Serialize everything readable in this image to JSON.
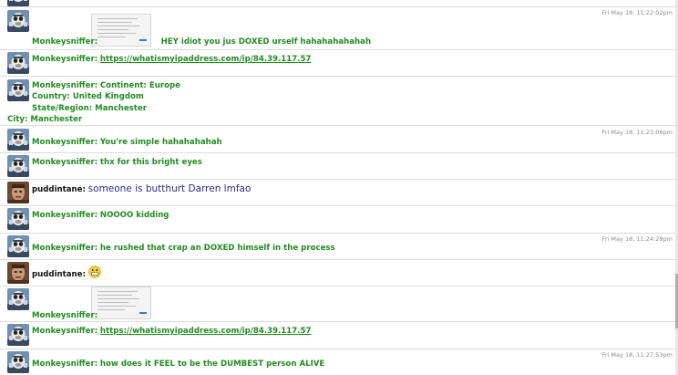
{
  "users": {
    "monkey": "Monkeysniffer:",
    "pudd": "puddintane:"
  },
  "colors": {
    "monkey_text": "#228b22",
    "pudd_text": "#2a2a8c",
    "timestamp": "#8c8c8c"
  },
  "messages": [
    {
      "time": "Fri May 18, 11:22:02pm",
      "text": "HEY idiot you jus DOXED urself hahahahahahah"
    },
    {
      "link": "https://whatismyipaddress.com/ip/84.39.117.57"
    },
    {
      "lines": [
        "Continent: Europe",
        "Country: United Kingdom",
        "State/Region: Manchester"
      ],
      "cont": "City: Manchester"
    },
    {
      "time": "Fri May 18, 11:23:06pm",
      "text": "You're simple hahahahahah"
    },
    {
      "text": "thx for this bright eyes"
    },
    {
      "text": "someone is butthurt Darren lmfao"
    },
    {
      "text": "NOOOO kidding"
    },
    {
      "time": "Fri May 18, 11:24:28pm",
      "text": "he rushed that crap an DOXED himself in the process"
    },
    {
      "emoji": "grinning-face-icon"
    },
    {
      "attachment": "screenshot-thumbnail"
    },
    {
      "link": "https://whatismyipaddress.com/ip/84.39.117.57"
    },
    {
      "time": "Fri May 18, 11:27:53pm",
      "text": "how does it FEEL to be the DUMBEST person ALIVE"
    }
  ]
}
